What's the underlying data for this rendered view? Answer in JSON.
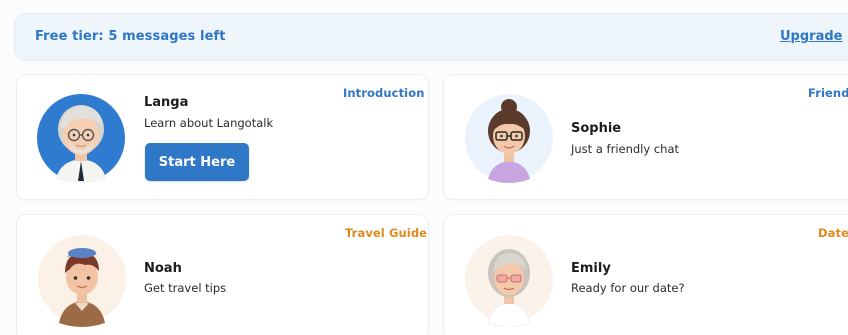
{
  "tier_bar": {
    "text": "Free tier: 5 messages left",
    "upgrade_label": "Upgrade"
  },
  "cards": [
    {
      "tag": "Introduction",
      "tag_color": "#2f76c6",
      "name": "Langa",
      "description": "Learn about Langotalk",
      "button_label": "Start Here",
      "avatar": "langa-avatar"
    },
    {
      "tag": "Friend",
      "tag_color": "#2f76c6",
      "name": "Sophie",
      "description": "Just a friendly chat",
      "avatar": "sophie-avatar"
    },
    {
      "tag": "Travel Guide",
      "tag_color": "#e0891d",
      "name": "Noah",
      "description": "Get travel tips",
      "avatar": "noah-avatar"
    },
    {
      "tag": "Date",
      "tag_color": "#e0891d",
      "name": "Emily",
      "description": "Ready for our date?",
      "avatar": "emily-avatar"
    }
  ]
}
